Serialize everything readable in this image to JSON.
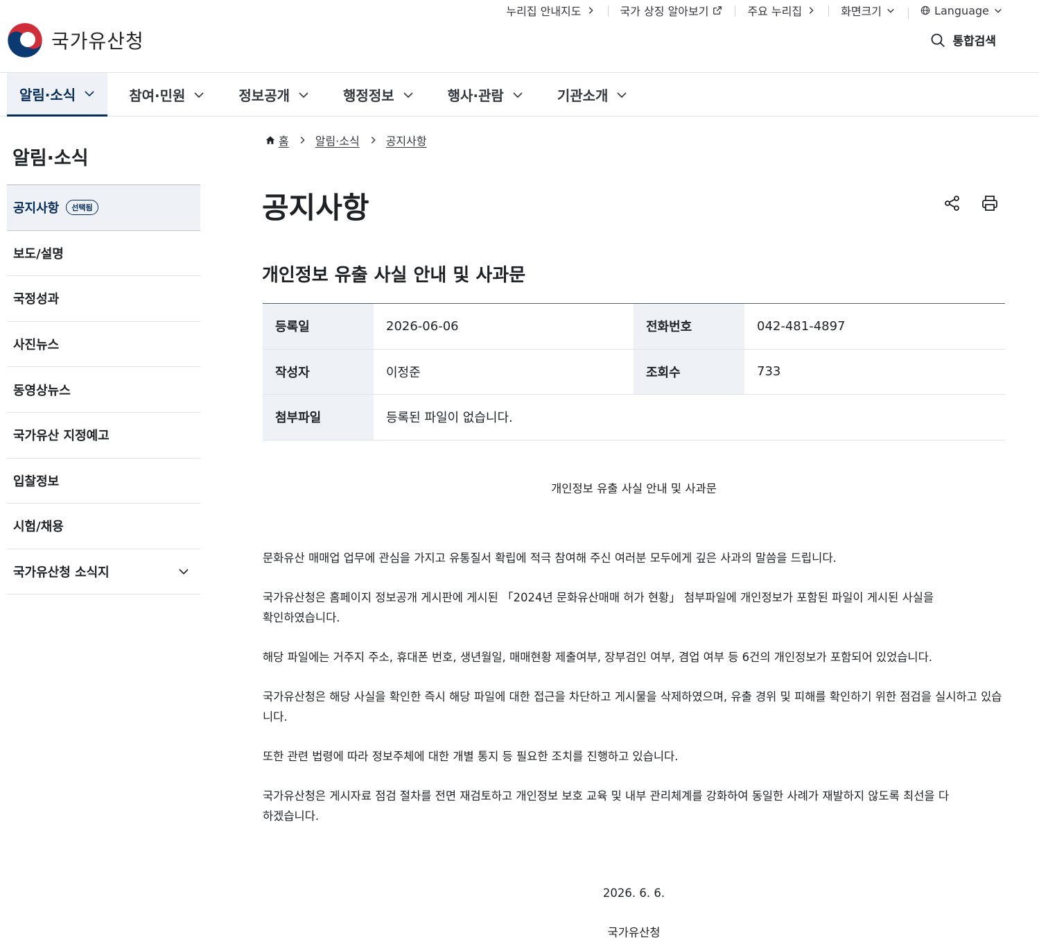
{
  "utility": {
    "guide_map": "누리집 안내지도",
    "symbols": "국가 상징 알아보기",
    "main_sites": "주요 누리집",
    "screen_size": "화면크기",
    "language": "Language"
  },
  "header": {
    "logo_text": "국가유산청",
    "search_label": "통합검색"
  },
  "gnb": [
    {
      "label": "알림·소식"
    },
    {
      "label": "참여·민원"
    },
    {
      "label": "정보공개"
    },
    {
      "label": "행정정보"
    },
    {
      "label": "행사·관람"
    },
    {
      "label": "기관소개"
    }
  ],
  "sidebar": {
    "title": "알림·소식",
    "selected_badge": "선택됨",
    "items": [
      {
        "label": "공지사항"
      },
      {
        "label": "보도/설명"
      },
      {
        "label": "국정성과"
      },
      {
        "label": "사진뉴스"
      },
      {
        "label": "동영상뉴스"
      },
      {
        "label": "국가유산 지정예고"
      },
      {
        "label": "입찰정보"
      },
      {
        "label": "시험/채용"
      },
      {
        "label": "국가유산청 소식지"
      }
    ]
  },
  "breadcrumb": {
    "home": "홈",
    "level1": "알림·소식",
    "level2": "공지사항"
  },
  "page_title": "공지사항",
  "post": {
    "title": "개인정보 유출 사실 안내 및 사과문",
    "fields": {
      "date_label": "등록일",
      "date_value": "2026-06-06",
      "phone_label": "전화번호",
      "phone_value": "042-481-4897",
      "author_label": "작성자",
      "author_value": "이정준",
      "views_label": "조회수",
      "views_value": "733",
      "attach_label": "첨부파일",
      "attach_value": "등록된 파일이 없습니다."
    },
    "body": {
      "heading": "개인정보 유출 사실 안내 및 사과문",
      "p1": "문화유산 매매업 업무에 관심을 가지고 유통질서 확립에 적극 참여해 주신 여러분 모두에게 깊은 사과의 말씀을 드립니다.",
      "p2": "국가유산청은 홈페이지 정보공개 게시판에 게시된 「2024년 문화유산매매 허가 현황」 첨부파일에 개인정보가 포함된 파일이 게시된 사실을 확인하였습니다.",
      "p3": "해당 파일에는 거주지 주소, 휴대폰 번호, 생년월일, 매매현황 제출여부, 장부검인 여부, 겸업 여부 등 6건의 개인정보가 포함되어 있었습니다.",
      "p4": "국가유산청은 해당 사실을 확인한 즉시 해당 파일에 대한 접근을 차단하고 게시물을 삭제하였으며, 유출 경위 및 피해를 확인하기 위한 점검을 실시하고 있습니다.",
      "p5": "또한 관련 법령에 따라 정보주체에 대한 개별 통지 등 필요한 조치를 진행하고 있습니다.",
      "p6": "국가유산청은 게시자료 점검 절차를 전면 재검토하고 개인정보 보호 교육 및 내부 관리체계를 강화하여 동일한 사례가 재발하지 않도록 최선을 다하겠습니다.",
      "date": "2026. 6. 6.",
      "org": "국가유산청"
    }
  },
  "colors": {
    "primary": "#052b57",
    "active_bg": "#eef2f7"
  }
}
